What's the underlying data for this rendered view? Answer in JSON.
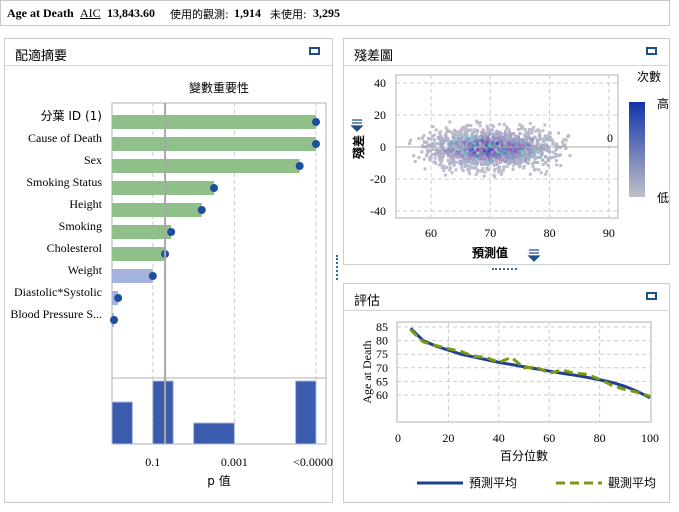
{
  "header": {
    "target": "Age at Death",
    "aic_label": "AIC",
    "aic_value": "13,843.60",
    "used_label": "使用的觀測:",
    "used_value": "1,914",
    "unused_label": "未使用:",
    "unused_value": "3,295"
  },
  "panels": {
    "fit_summary": "配適摘要",
    "residual": "殘差圖",
    "assessment": "評估"
  },
  "chart_data": [
    {
      "type": "bar",
      "title": "變數重要性",
      "xlabel": "p 值",
      "xticks": [
        "0.1",
        "0.001",
        "<0.00001"
      ],
      "categories": [
        "分葉 ID (1)",
        "Cause of Death",
        "Sex",
        "Smoking Status",
        "Height",
        "Smoking",
        "Cholesterol",
        "Weight",
        "Diastolic*Systolic",
        "Blood Pressure S..."
      ],
      "neg_log10_p": [
        5,
        5,
        4.6,
        2.5,
        2.2,
        1.45,
        1.3,
        1.0,
        0.15,
        0.05
      ],
      "significant": [
        true,
        true,
        true,
        true,
        true,
        true,
        true,
        false,
        false,
        false
      ],
      "reference_line": 0.05,
      "histogram": {
        "bins": [
          [
            0,
            0.5
          ],
          [
            1,
            1.5
          ],
          [
            2,
            3
          ],
          [
            4.5,
            5
          ]
        ],
        "counts": [
          2,
          3,
          1,
          3
        ]
      },
      "colors": {
        "significant": "#8fc08a",
        "not_significant": "#a3b3dd",
        "dot": "#1f4ea0",
        "hist": "#3b5bad"
      }
    },
    {
      "type": "heatmap",
      "title": "",
      "xlabel": "預測值",
      "ylabel": "殘差",
      "xlim": [
        55,
        92
      ],
      "ylim": [
        -45,
        45
      ],
      "xticks": [
        60,
        70,
        80,
        90
      ],
      "yticks": [
        -40,
        -20,
        0,
        20,
        40
      ],
      "reference_label": "0",
      "legend": {
        "title": "次數",
        "high": "高",
        "low": "低",
        "colors": [
          "#1234a8",
          "#c0c0c8"
        ]
      }
    },
    {
      "type": "line",
      "title": "",
      "xlabel": "百分位數",
      "ylabel": "Age at Death",
      "xlim": [
        0,
        100
      ],
      "ylim": [
        57,
        87
      ],
      "xticks": [
        0,
        20,
        40,
        60,
        80,
        100
      ],
      "yticks": [
        60,
        65,
        70,
        75,
        80,
        85
      ],
      "x": [
        5,
        10,
        15,
        20,
        25,
        30,
        35,
        40,
        45,
        50,
        55,
        60,
        65,
        70,
        75,
        80,
        85,
        90,
        95,
        100
      ],
      "series": [
        {
          "name": "預測平均",
          "color": "#1f3f8f",
          "dash": false,
          "values": [
            84.5,
            80,
            78,
            76.5,
            75,
            74,
            73,
            72,
            71.2,
            70.4,
            69.6,
            68.8,
            68,
            67.3,
            66.5,
            65.6,
            64.6,
            63.2,
            61.3,
            59
          ]
        },
        {
          "name": "觀測平均",
          "color": "#7a9a10",
          "dash": true,
          "values": [
            84,
            79.5,
            78.2,
            77,
            76,
            74.2,
            73.8,
            72,
            73.8,
            70,
            70.2,
            68,
            69.2,
            68,
            67.6,
            65.8,
            63.5,
            62,
            61,
            59.5
          ]
        }
      ]
    }
  ]
}
